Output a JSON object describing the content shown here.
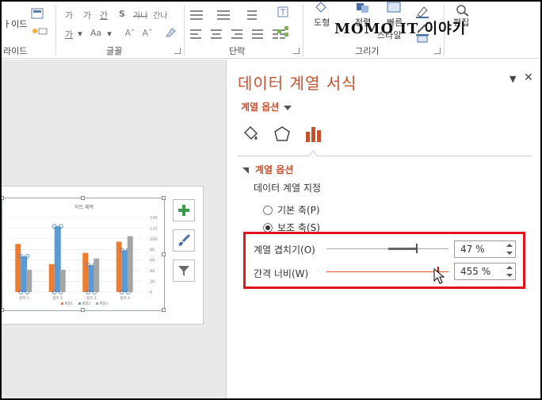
{
  "ribbon": {
    "group_slides_label": "라이드",
    "slide_layout_label": "ㅏ이드",
    "group_font_label": "글꼴",
    "group_paragraph_label": "단락",
    "group_drawing_label": "그리기",
    "font_row1": [
      "가",
      "가",
      "간",
      "S",
      "가나",
      "간나"
    ],
    "font_row2": [
      "가",
      "Aa"
    ],
    "shapes_label": "도형",
    "arrange_label": "정렬",
    "quick_styles_label": "빠른",
    "quick_styles_label2": "스타일",
    "edit_label": "편집",
    "watermark_text": "MOMO IT 이야기"
  },
  "chart": {
    "title": "차트 제목",
    "categories": [
      "항목 1",
      "항목 2",
      "항목 3",
      "항목 4"
    ],
    "series": [
      {
        "name": "계열1",
        "color": "#ed7d31"
      },
      {
        "name": "계열2",
        "color": "#5b9bd5"
      },
      {
        "name": "계열3",
        "color": "#a5a5a5"
      }
    ],
    "right_axis_ticks": [
      "140",
      "120",
      "100",
      "80",
      "60",
      "40",
      "20",
      "0"
    ],
    "tools": [
      "add-element-icon",
      "style-brush-icon",
      "filter-icon"
    ]
  },
  "chart_data": {
    "type": "bar",
    "title": "차트 제목",
    "categories": [
      "항목 1",
      "항목 2",
      "항목 3",
      "항목 4"
    ],
    "series": [
      {
        "name": "계열1",
        "values": [
          4.3,
          2.5,
          3.5,
          4.5
        ]
      },
      {
        "name": "계열2",
        "values": [
          2.4,
          4.4,
          1.8,
          2.8
        ]
      },
      {
        "name": "계열3",
        "values": [
          2,
          2,
          3,
          5
        ]
      }
    ],
    "secondary_axis_series": "계열2",
    "y2lim": [
      0,
      140
    ]
  },
  "pane": {
    "title": "데이터 계열 서식",
    "series_options_dropdown": "계열 옵션",
    "section_title": "계열 옵션",
    "plot_on_label": "데이터 계열 지정",
    "radio_primary": "기본 축(P)",
    "radio_secondary": "보조 축(S)",
    "overlap_label": "계열 겹치기(O)",
    "overlap_value": "47 %",
    "overlap_fraction": 0.735,
    "gap_label": "간격 너비(W)",
    "gap_value": "455 %",
    "gap_fraction": 0.91,
    "icons": [
      "fill-bucket-icon",
      "pentagon-effects-icon",
      "bar-chart-options-icon"
    ],
    "accent_color": "#c5522f",
    "highlight_color": "#e1141d"
  }
}
